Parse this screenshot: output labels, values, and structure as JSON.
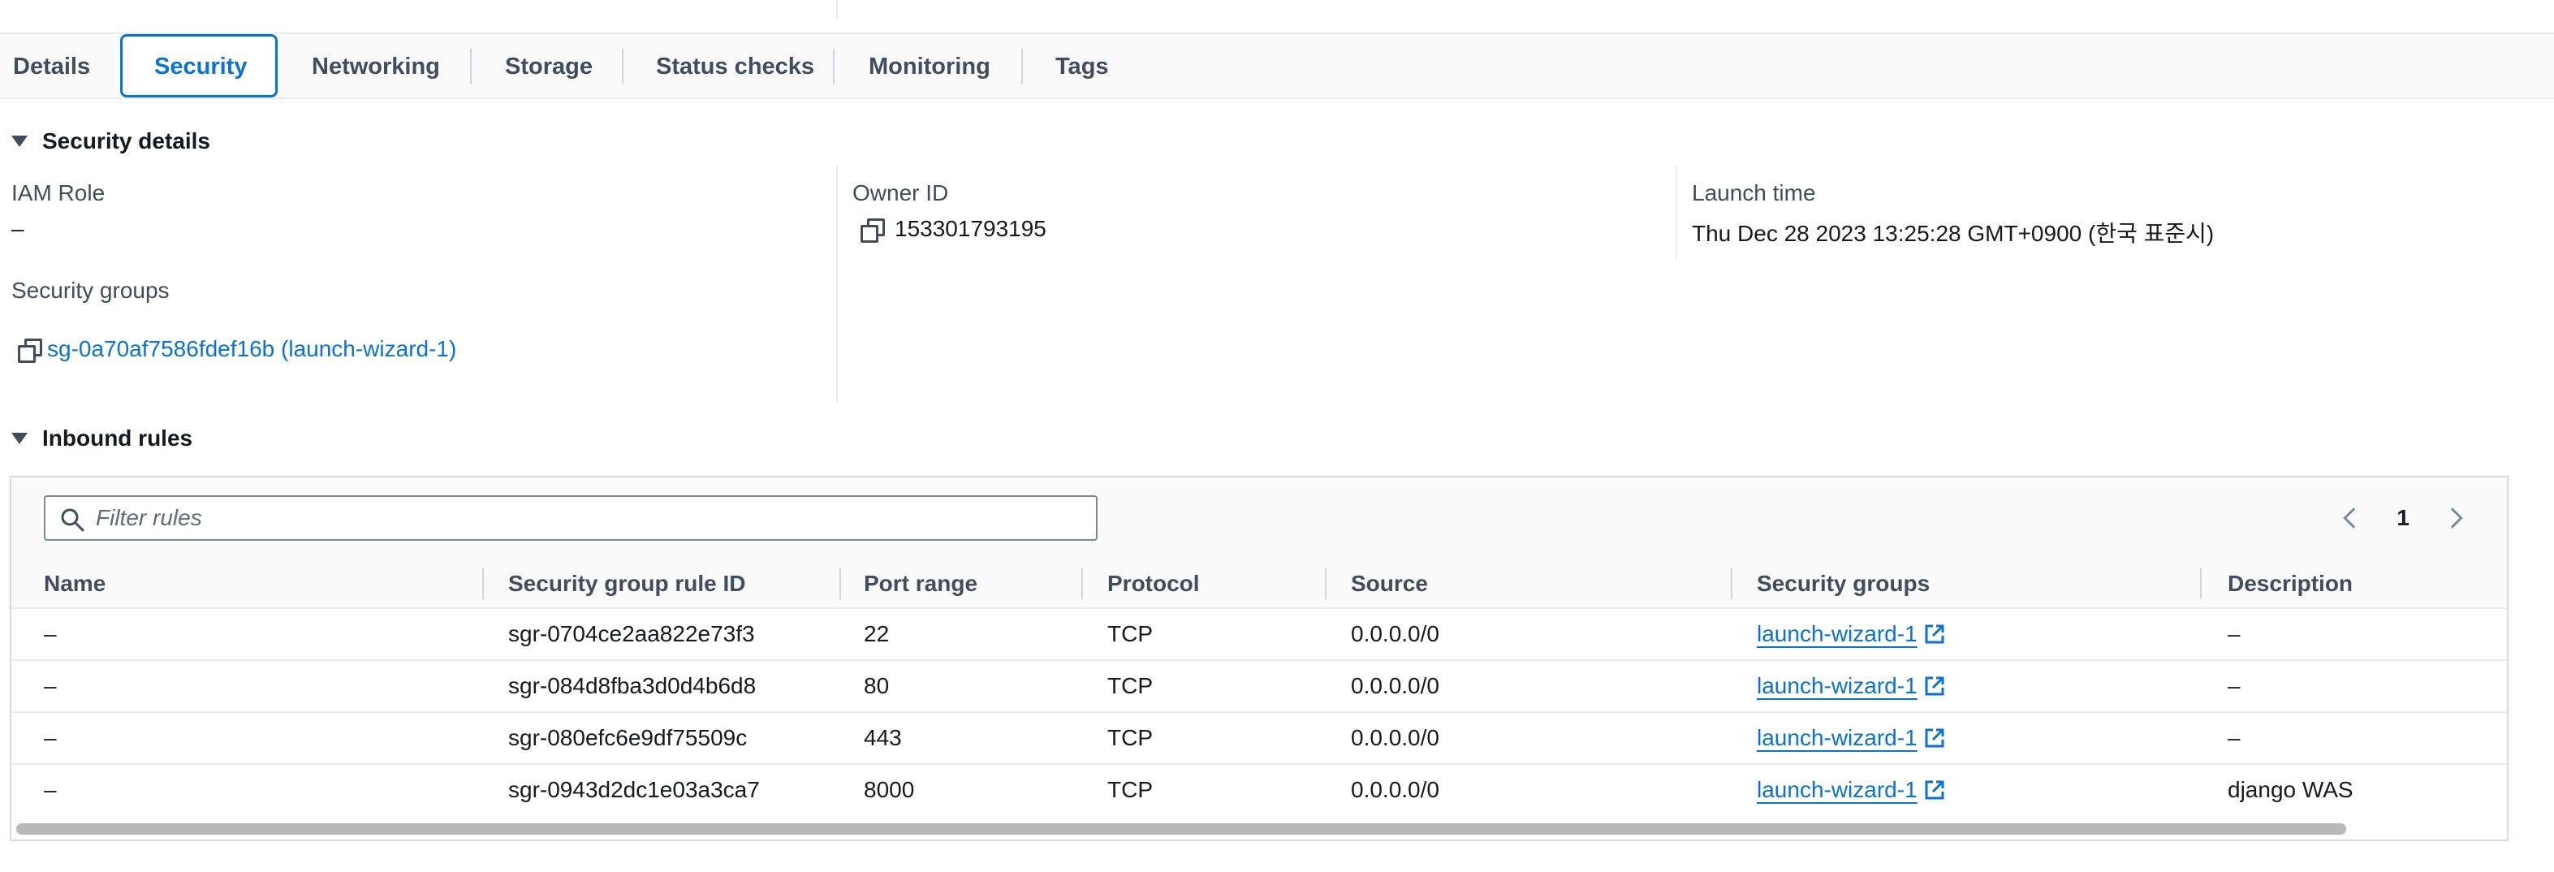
{
  "tabs": [
    "Details",
    "Security",
    "Networking",
    "Storage",
    "Status checks",
    "Monitoring",
    "Tags"
  ],
  "active_tab": "Security",
  "security_details": {
    "heading": "Security details",
    "iam_role_label": "IAM Role",
    "iam_role_value": "–",
    "owner_id_label": "Owner ID",
    "owner_id_value": "153301793195",
    "launch_time_label": "Launch time",
    "launch_time_value": "Thu Dec 28 2023 13:25:28 GMT+0900 (한국 표준시)",
    "security_groups_label": "Security groups",
    "security_groups_value": "sg-0a70af7586fdef16b (launch-wizard-1)"
  },
  "inbound_rules": {
    "heading": "Inbound rules",
    "filter_placeholder": "Filter rules",
    "page": "1",
    "columns": [
      "Name",
      "Security group rule ID",
      "Port range",
      "Protocol",
      "Source",
      "Security groups",
      "Description"
    ],
    "rows": [
      {
        "name": "–",
        "rule_id": "sgr-0704ce2aa822e73f3",
        "port": "22",
        "protocol": "TCP",
        "source": "0.0.0.0/0",
        "sg": "launch-wizard-1",
        "description": "–"
      },
      {
        "name": "–",
        "rule_id": "sgr-084d8fba3d0d4b6d8",
        "port": "80",
        "protocol": "TCP",
        "source": "0.0.0.0/0",
        "sg": "launch-wizard-1",
        "description": "–"
      },
      {
        "name": "–",
        "rule_id": "sgr-080efc6e9df75509c",
        "port": "443",
        "protocol": "TCP",
        "source": "0.0.0.0/0",
        "sg": "launch-wizard-1",
        "description": "–"
      },
      {
        "name": "–",
        "rule_id": "sgr-0943d2dc1e03a3ca7",
        "port": "8000",
        "protocol": "TCP",
        "source": "0.0.0.0/0",
        "sg": "launch-wizard-1",
        "description": "django WAS"
      }
    ]
  },
  "colors": {
    "accent": "#0972d3",
    "text": "#16191f",
    "muted": "#414d5c",
    "border": "#e9ebed"
  },
  "icons": [
    "copy-icon",
    "search-icon",
    "chevron-left-icon",
    "chevron-right-icon",
    "external-link-icon",
    "caret-down-icon"
  ]
}
